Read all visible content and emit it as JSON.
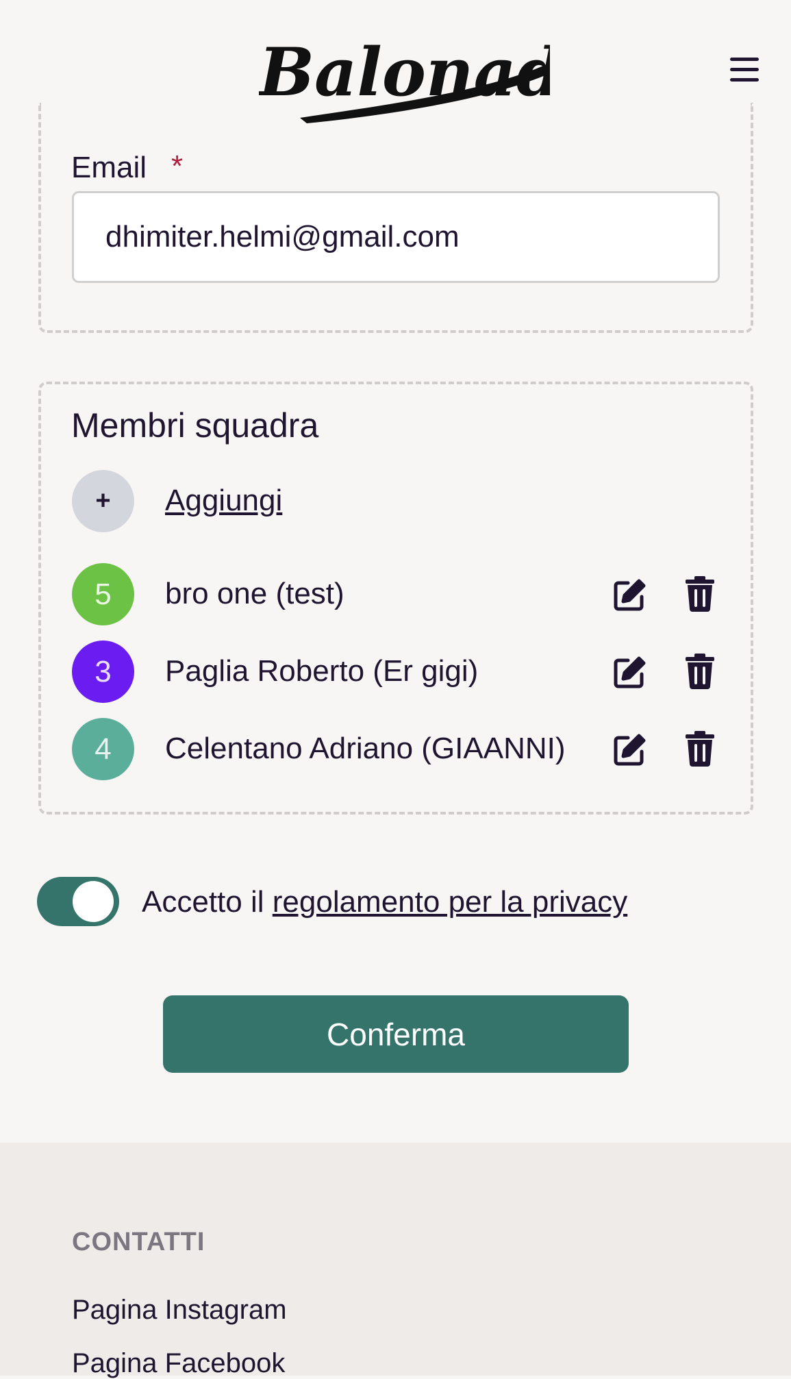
{
  "header": {
    "logo_text": "Balonade",
    "menu_icon": "hamburger-menu-icon"
  },
  "email_section": {
    "label": "Email",
    "required_marker": "*",
    "value": "dhimiter.helmi@gmail.com"
  },
  "members_section": {
    "title": "Membri squadra",
    "add_symbol": "+",
    "add_label": "Aggiungi",
    "members": [
      {
        "number": "5",
        "name": "bro one (test)",
        "color": "#6cc244"
      },
      {
        "number": "3",
        "name": "Paglia Roberto (Er gigi)",
        "color": "#6b1cf1"
      },
      {
        "number": "4",
        "name": "Celentano Adriano (GIAANNI)",
        "color": "#5aae9a"
      }
    ],
    "edit_icon": "pencil-square-icon",
    "delete_icon": "trash-icon"
  },
  "privacy": {
    "toggle_on": true,
    "text_prefix": "Accetto il",
    "link_text": "regolamento per la privacy"
  },
  "confirm_button": "Conferma",
  "footer": {
    "heading": "CONTATTI",
    "links": [
      "Pagina Instagram",
      "Pagina Facebook"
    ]
  },
  "colors": {
    "accent": "#35746b",
    "background": "#f8f6f5",
    "footer_background": "#eeebe8",
    "required": "#b01c3c"
  }
}
